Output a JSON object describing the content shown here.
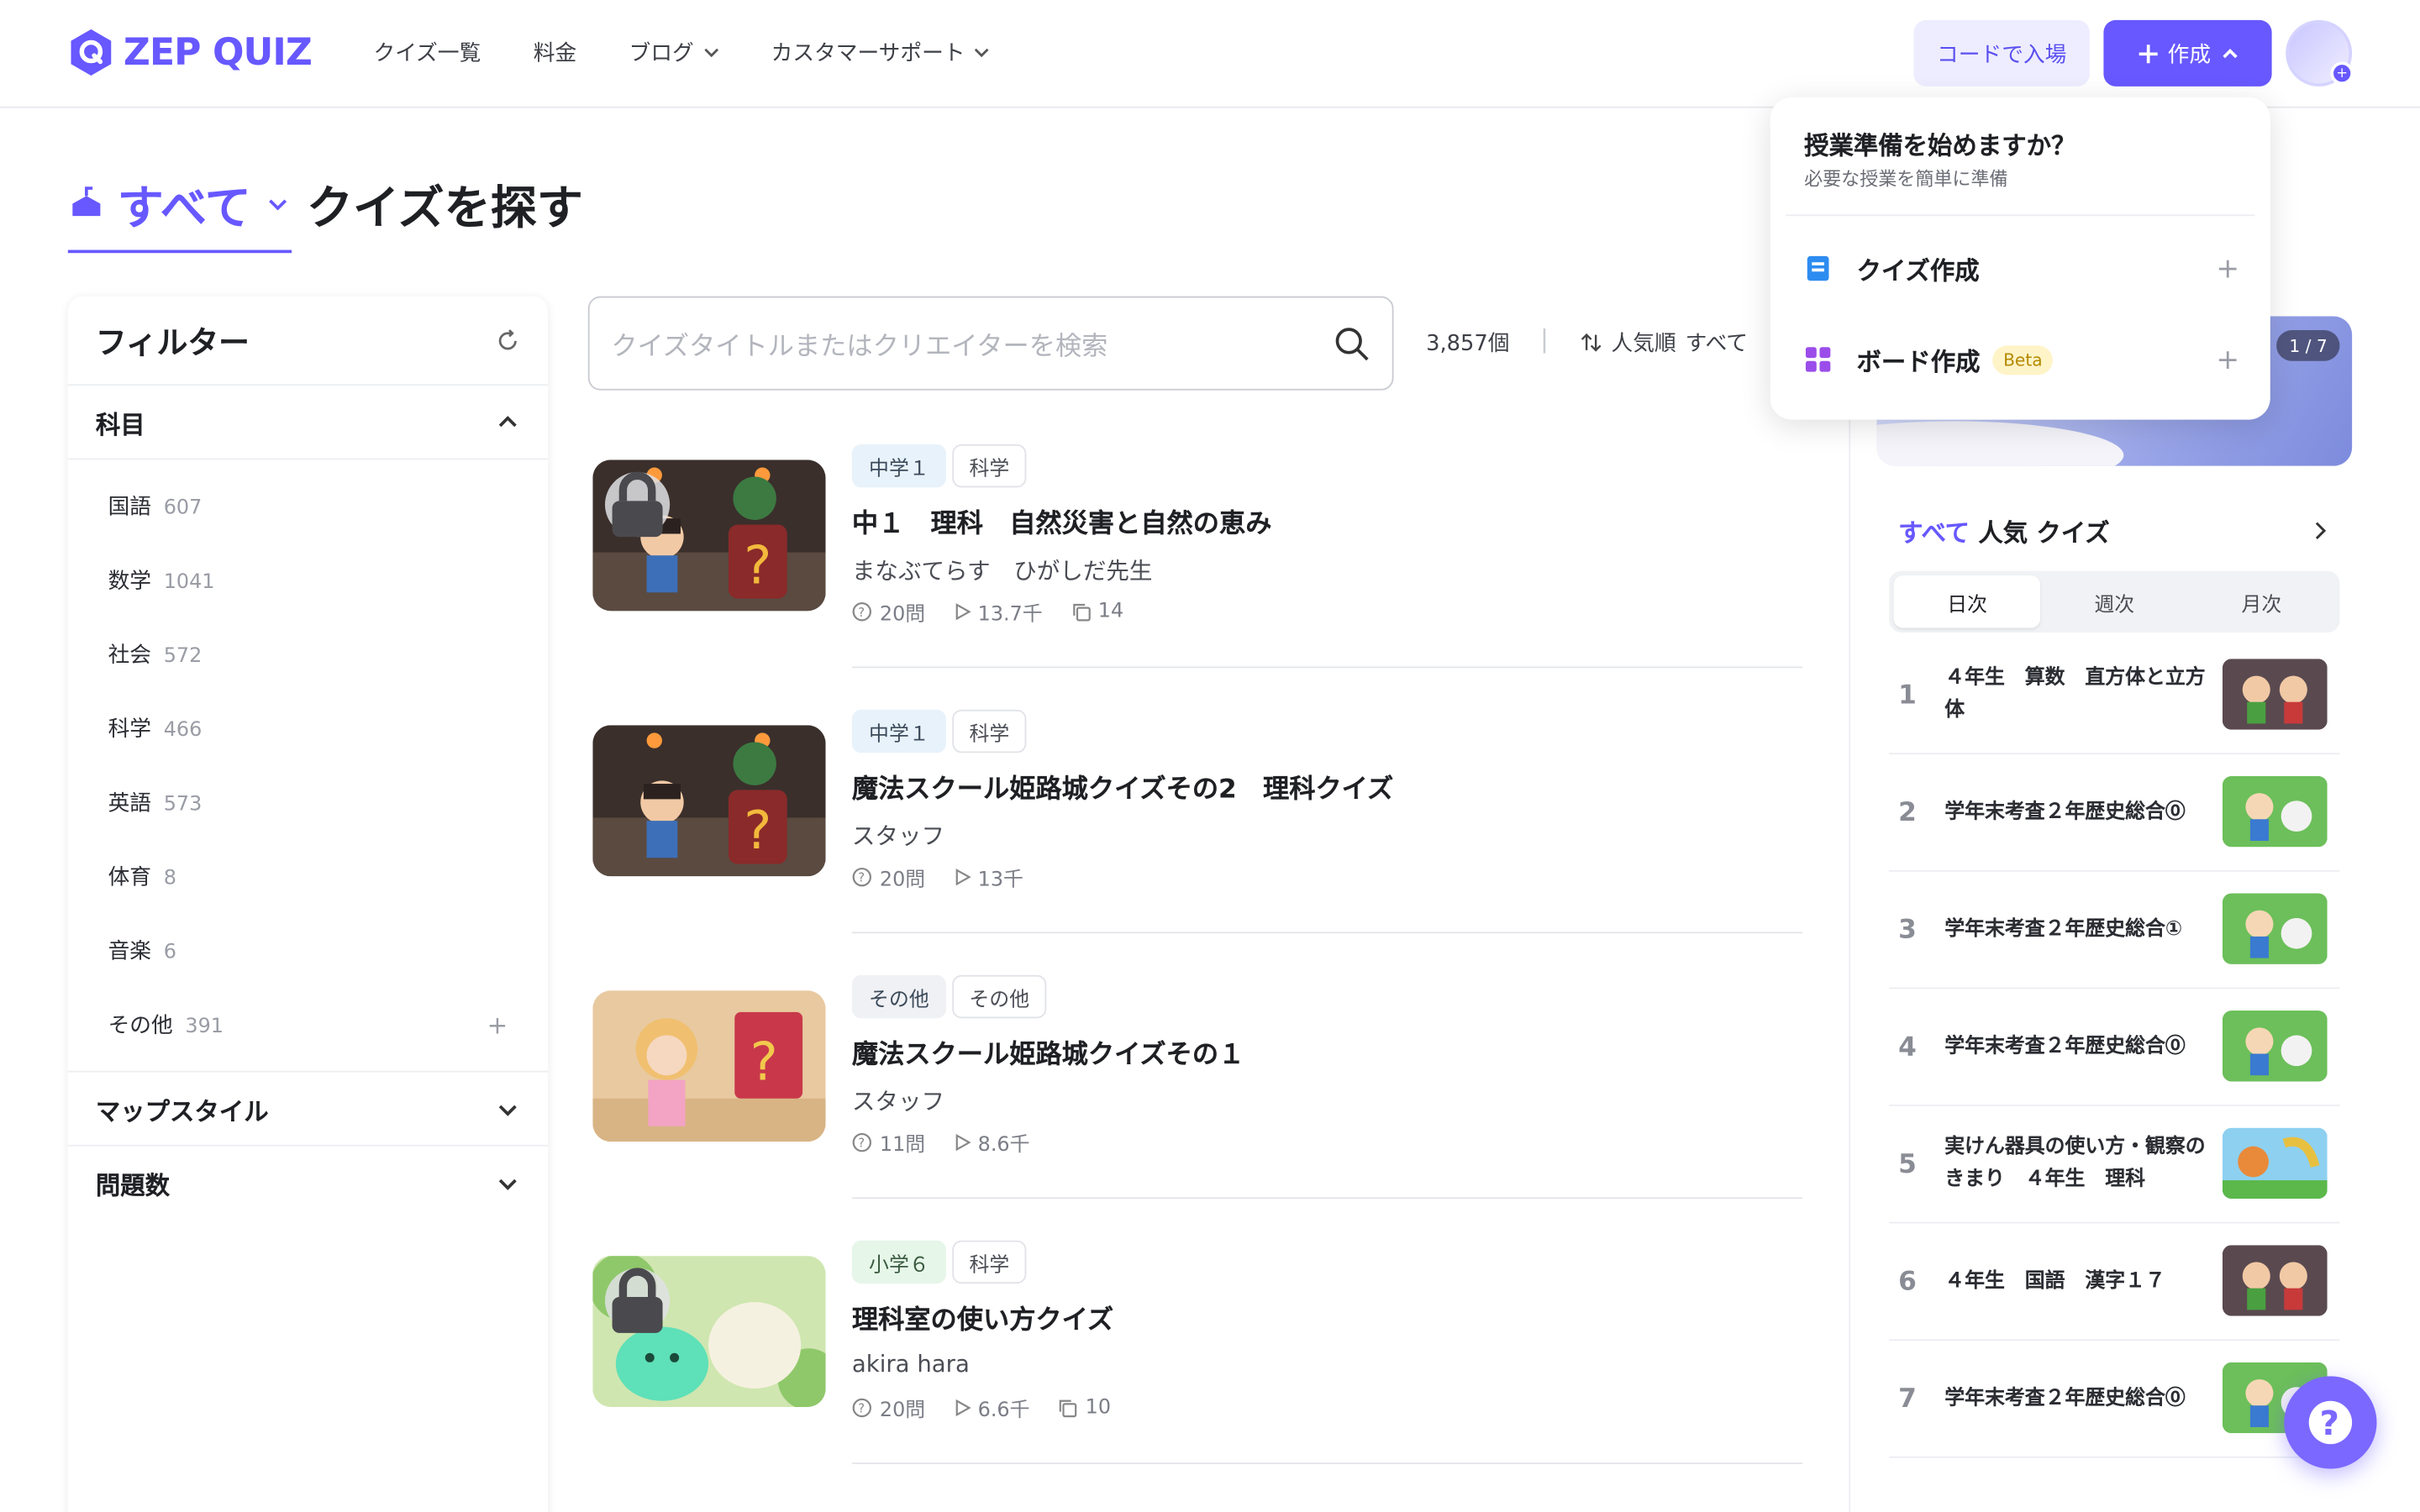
{
  "brand": {
    "name": "ZEP QUIZ",
    "color": "#6758ff"
  },
  "nav": {
    "items": [
      {
        "label": "クイズ一覧"
      },
      {
        "label": "料金"
      },
      {
        "label": "ブログ"
      },
      {
        "label": "カスタマーサポート"
      }
    ],
    "code_entry": "コードで入場",
    "create": "作成"
  },
  "page": {
    "category": "すべて",
    "title": "クイズを探す"
  },
  "filter": {
    "title": "フィルター",
    "subject_header": "科目",
    "subjects": [
      {
        "name": "国語",
        "count": "607"
      },
      {
        "name": "数学",
        "count": "1041"
      },
      {
        "name": "社会",
        "count": "572"
      },
      {
        "name": "科学",
        "count": "466"
      },
      {
        "name": "英語",
        "count": "573"
      },
      {
        "name": "体育",
        "count": "8"
      },
      {
        "name": "音楽",
        "count": "6"
      },
      {
        "name": "その他",
        "count": "391"
      }
    ],
    "map_style": "マップスタイル",
    "question_count": "問題数"
  },
  "search": {
    "placeholder": "クイズタイトルまたはクリエイターを検索"
  },
  "results": {
    "count": "3,857個",
    "sort": "人気順",
    "scope": "すべて"
  },
  "quizzes": [
    {
      "tags": [
        "中学１",
        "科学"
      ],
      "title": "中１　理科　自然災害と自然の恵み",
      "author": "まなぶてらす　ひがしだ先生",
      "questions": "20問",
      "plays": "13.7千",
      "copies": "14",
      "locked": true
    },
    {
      "tags": [
        "中学１",
        "科学"
      ],
      "title": "魔法スクール姫路城クイズその2　理科クイズ",
      "author": "スタッフ",
      "questions": "20問",
      "plays": "13千",
      "copies": "",
      "locked": false
    },
    {
      "tags": [
        "その他",
        "その他"
      ],
      "title": "魔法スクール姫路城クイズその１",
      "author": "スタッフ",
      "questions": "11問",
      "plays": "8.6千",
      "copies": "",
      "locked": false
    },
    {
      "tags": [
        "小学６",
        "科学"
      ],
      "title": "理科室の使い方クイズ",
      "author": "akira hara",
      "questions": "20問",
      "plays": "6.6千",
      "copies": "10",
      "locked": true
    }
  ],
  "banner": {
    "page": "1 / 7"
  },
  "popular": {
    "accent": "すべて",
    "title": "人気 クイズ",
    "periods": [
      "日次",
      "週次",
      "月次"
    ],
    "items": [
      {
        "rank": "1",
        "title": "４年生　算数　直方体と立方体"
      },
      {
        "rank": "2",
        "title": "学年末考査２年歴史総合⓪"
      },
      {
        "rank": "3",
        "title": "学年末考査２年歴史総合①"
      },
      {
        "rank": "4",
        "title": "学年末考査２年歴史総合⓪"
      },
      {
        "rank": "5",
        "title": "実けん器具の使い方・観察のきまり　４年生　理科"
      },
      {
        "rank": "6",
        "title": "４年生　国語　漢字１７"
      },
      {
        "rank": "7",
        "title": "学年末考査２年歴史総合⓪"
      }
    ]
  },
  "dropdown": {
    "title": "授業準備を始めますか？",
    "subtitle": "必要な授業を簡単に準備",
    "quiz_create": "クイズ作成",
    "board_create": "ボード作成",
    "beta": "Beta"
  }
}
